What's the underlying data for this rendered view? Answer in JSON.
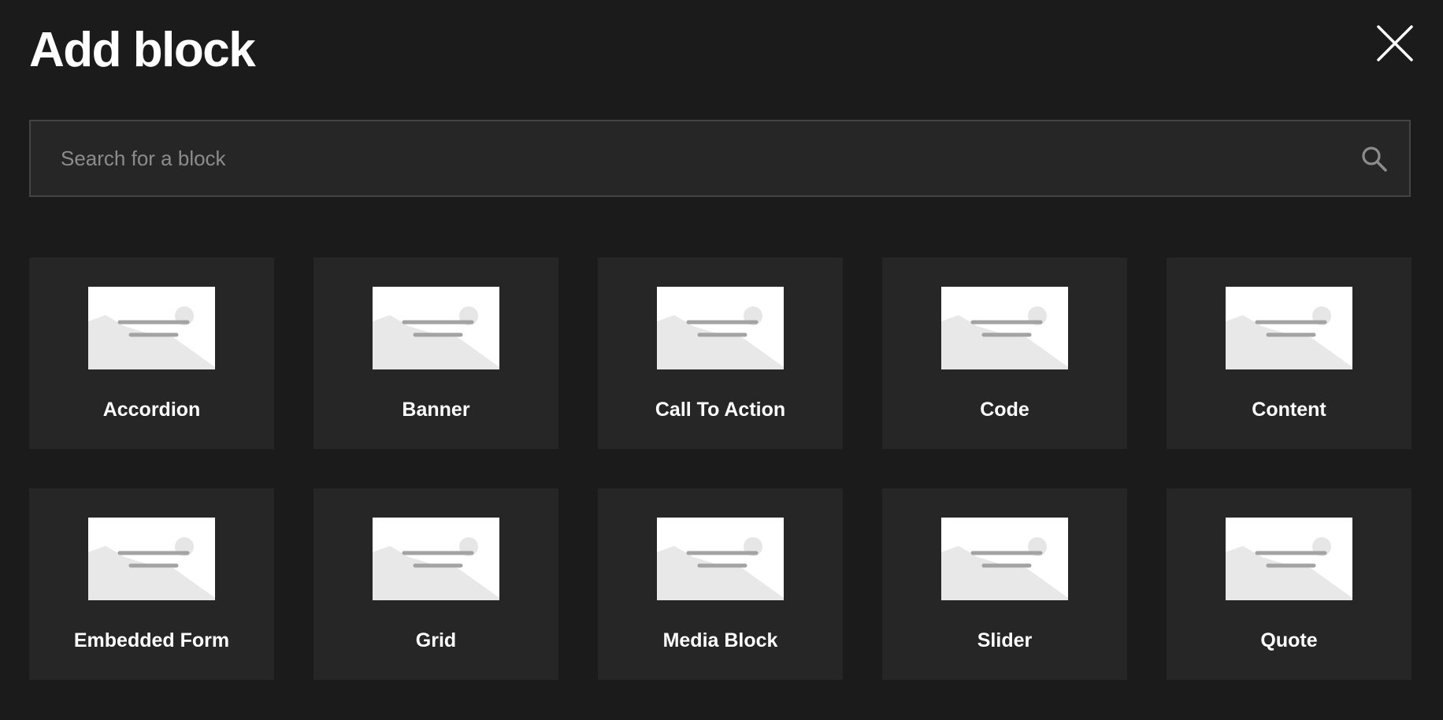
{
  "header": {
    "title": "Add block"
  },
  "close": {
    "icon": "close-icon"
  },
  "search": {
    "placeholder": "Search for a block",
    "value": "",
    "icon": "search-icon"
  },
  "blocks": [
    {
      "label": "Accordion",
      "icon": "placeholder-image-icon"
    },
    {
      "label": "Banner",
      "icon": "placeholder-image-icon"
    },
    {
      "label": "Call To Action",
      "icon": "placeholder-image-icon"
    },
    {
      "label": "Code",
      "icon": "placeholder-image-icon"
    },
    {
      "label": "Content",
      "icon": "placeholder-image-icon"
    },
    {
      "label": "Embedded Form",
      "icon": "placeholder-image-icon"
    },
    {
      "label": "Grid",
      "icon": "placeholder-image-icon"
    },
    {
      "label": "Media Block",
      "icon": "placeholder-image-icon"
    },
    {
      "label": "Slider",
      "icon": "placeholder-image-icon"
    },
    {
      "label": "Quote",
      "icon": "placeholder-image-icon"
    }
  ],
  "colors": {
    "background": "#1b1b1b",
    "card": "#262626",
    "search_border": "#444444",
    "text": "#ffffff",
    "placeholder": "#8c8c8c"
  }
}
